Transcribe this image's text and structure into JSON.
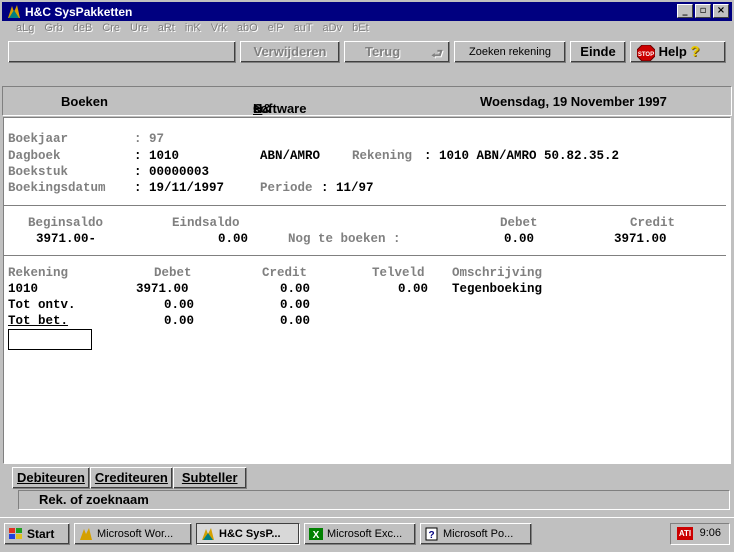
{
  "window": {
    "title": "H&C SysPakketten",
    "minimize": "_",
    "maximize": "▫",
    "close": "×"
  },
  "menubar": [
    "aLg",
    "Grb",
    "deB",
    "Cre",
    "Ure",
    "aRt",
    "inK",
    "Vrk",
    "abO",
    "elP",
    "auT",
    "aDv",
    "bEt"
  ],
  "toolbar": {
    "delete_label": "Verwijderen",
    "back_label": "Terug",
    "search_account_label": "Zoeken rekening",
    "end_label": "Einde",
    "help_label": "Help",
    "help_mark": "?"
  },
  "header": {
    "section": "Boeken",
    "company_pre": "H&",
    "company_u": "C",
    "company_post": " software b.v.",
    "date": "Woensdag, 19 November 1997"
  },
  "info": {
    "boekjaar_label": "Boekjaar",
    "boekjaar_value": ": 97",
    "dagboek_label": "Dagboek",
    "dagboek_value": ": 1010",
    "dagboek_name": "ABN/AMRO",
    "rekening_label": "Rekening",
    "rekening_value": ": 1010 ABN/AMRO 50.82.35.2",
    "boekstuk_label": "Boekstuk",
    "boekstuk_value": ": 00000003",
    "boekingsdatum_label": "Boekingsdatum",
    "boekingsdatum_value": ": 19/11/1997",
    "periode_label": "Periode",
    "periode_value": ": 11/97"
  },
  "saldo": {
    "beginsaldo_label": "Beginsaldo",
    "beginsaldo_value": "3971.00-",
    "eindsaldo_label": "Eindsaldo",
    "eindsaldo_value": "0.00",
    "nog_label": "Nog te boeken :",
    "debet_label": "Debet",
    "debet_value": "0.00",
    "credit_label": "Credit",
    "credit_value": "3971.00"
  },
  "table": {
    "headers": [
      "Rekening",
      "Debet",
      "Credit",
      "Telveld",
      "Omschrijving"
    ],
    "rows": [
      {
        "rekening": "1010",
        "debet": "3971.00",
        "credit": "0.00",
        "telveld": "0.00",
        "omschrijving": "Tegenboeking"
      },
      {
        "rekening": "Tot ontv.",
        "debet": "0.00",
        "credit": "0.00"
      },
      {
        "rekening": "Tot bet.",
        "debet": "0.00",
        "credit": "0.00"
      }
    ]
  },
  "tabs": [
    "Debiteuren",
    "Crediteuren",
    "Subteller"
  ],
  "status": "Rek. of zoeknaam",
  "taskbar": {
    "start": "Start",
    "tasks": [
      "Microsoft Wor...",
      "H&C SysP...",
      "Microsoft Exc...",
      "Microsoft Po..."
    ],
    "time": "9:06"
  },
  "colors": {
    "titlebar": "#000080",
    "face": "#c0c0c0",
    "stop_red": "#cc0000",
    "help_yellow": "#ffd700"
  }
}
